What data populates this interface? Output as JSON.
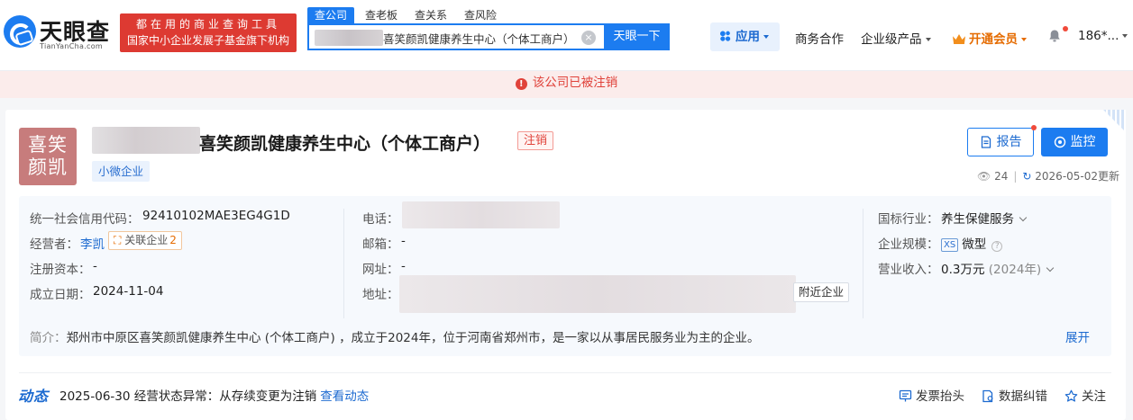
{
  "brand": {
    "name": "天眼查",
    "domain": "TianYanCha.com",
    "slogan_line1": "都在用的商业查询工具",
    "slogan_line2": "国家中小企业发展子基金旗下机构"
  },
  "search": {
    "tabs": [
      "查公司",
      "查老板",
      "查关系",
      "查风险"
    ],
    "value": "喜笑颜凯健康养生中心（个体工商户）",
    "clear_icon": "close-circle-icon",
    "button": "天眼一下"
  },
  "nav": {
    "apps": "应用",
    "items": [
      "商务合作",
      "企业级产品"
    ],
    "vip": "开通会员",
    "user": "186*..."
  },
  "notice": {
    "text": "该公司已被注销",
    "icon": "alert-circle-icon"
  },
  "company": {
    "logo_line1": "喜笑",
    "logo_line2": "颜凯",
    "name": "喜笑颜凯健康养生中心（个体工商户）",
    "status": "注销",
    "size_tag": "小微企业",
    "report_btn": "报告",
    "monitor_btn": "监控",
    "views": "24",
    "updated": "2026-05-02更新"
  },
  "info": {
    "left": {
      "credit_code_label": "统一社会信用代码：",
      "credit_code": "92410102MAE3EG4G1D",
      "operator_label": "经营者：",
      "operator": "李凯",
      "related_label": "关联企业",
      "related_count": "2",
      "capital_label": "注册资本：",
      "capital": "-",
      "founded_label": "成立日期：",
      "founded": "2024-11-04"
    },
    "middle": {
      "phone_label": "电话：",
      "email_label": "邮箱：",
      "email": "-",
      "website_label": "网址：",
      "website": "-",
      "address_label": "地址：",
      "nearby": "附近企业"
    },
    "right": {
      "industry_label": "国标行业：",
      "industry": "养生保健服务",
      "scale_label": "企业规模：",
      "scale_badge": "XS",
      "scale": "微型",
      "revenue_label": "营业收入：",
      "revenue": "0.3万元",
      "revenue_year": "(2024年)"
    },
    "intro_label": "简介：",
    "intro": "郑州市中原区喜笑颜凯健康养生中心 (个体工商户) ，成立于2024年，位于河南省郑州市，是一家以从事居民服务业为主的企业。",
    "expand": "展开"
  },
  "dynamics": {
    "title": "动态",
    "date": "2025-06-30",
    "text": "经营状态异常：从存续变更为注销",
    "link": "查看动态"
  },
  "actions": [
    "发票抬头",
    "数据纠错",
    "关注"
  ],
  "colors": {
    "primary": "#1c7cf0",
    "danger": "#e0423a",
    "notice_bg": "#fbeceb",
    "logo_bg": "#c77c7c",
    "vip": "#e56b00"
  }
}
